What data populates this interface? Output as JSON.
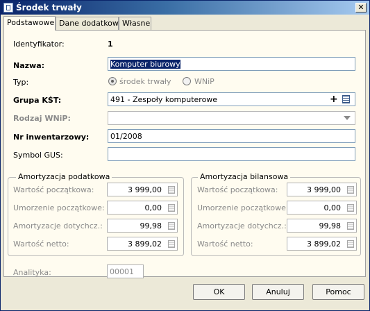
{
  "window": {
    "title": "Środek trwały"
  },
  "tabs": [
    {
      "label": "Podstawowe"
    },
    {
      "label": "Dane dodatkowe"
    },
    {
      "label": "Własne"
    }
  ],
  "form": {
    "identyfikator": {
      "label": "Identyfikator:",
      "value": "1"
    },
    "nazwa": {
      "label": "Nazwa:",
      "value": "Komputer biurowy"
    },
    "typ": {
      "label": "Typ:",
      "options": [
        "środek trwały",
        "WNiP"
      ],
      "selected": "środek trwały"
    },
    "grupa_kst": {
      "label": "Grupa KŚT:",
      "value": "491 - Zespoły komputerowe",
      "add_glyph": "+"
    },
    "rodzaj_wnip": {
      "label": "Rodzaj WNiP:",
      "value": ""
    },
    "nr_inwentarzowy": {
      "label": "Nr inwentarzowy:",
      "value": "01/2008"
    },
    "symbol_gus": {
      "label": "Symbol GUS:",
      "value": ""
    },
    "analityka": {
      "label": "Analityka:",
      "value": "00001"
    }
  },
  "amortyzacja_podatkowa": {
    "title": "Amortyzacja podatkowa",
    "rows": [
      {
        "label": "Wartość początkowa:",
        "value": "3 999,00"
      },
      {
        "label": "Umorzenie początkowe:",
        "value": "0,00"
      },
      {
        "label": "Amortyzacje dotychcz.:",
        "value": "99,98"
      },
      {
        "label": "Wartość netto:",
        "value": "3 899,02"
      }
    ]
  },
  "amortyzacja_bilansowa": {
    "title": "Amortyzacja bilansowa",
    "rows": [
      {
        "label": "Wartość początkowa:",
        "value": "3 999,00"
      },
      {
        "label": "Umorzenie początkowe:",
        "value": "0,00"
      },
      {
        "label": "Amortyzacje dotychcz.:",
        "value": "99,98"
      },
      {
        "label": "Wartość netto:",
        "value": "3 899,02"
      }
    ]
  },
  "buttons": {
    "ok": "OK",
    "cancel": "Anuluj",
    "help": "Pomoc"
  }
}
